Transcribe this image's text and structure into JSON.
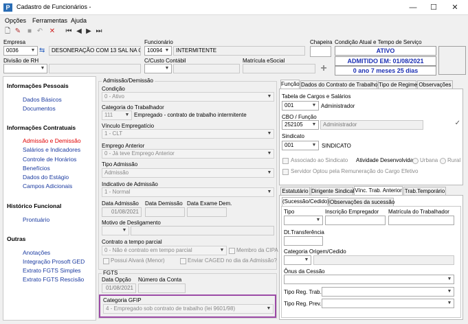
{
  "window": {
    "title": "Cadastro de Funcionários -",
    "icon_letter": "P",
    "minimize": "—",
    "maximize": "☐",
    "close": "✕"
  },
  "menu": [
    "Opções",
    "Ferramentas",
    "Ajuda"
  ],
  "header": {
    "empresa_label": "Empresa",
    "empresa_code": "0036",
    "empresa_name": "DESONERAÇÃO COM 13 SAL NA QUITAÇÃO",
    "funcionario_label": "Funcionário",
    "funcionario_code": "10094",
    "funcionario_name": "INTERMITENTE",
    "chapeira_label": "Chapeira",
    "condicao_label": "Condição Atual e Tempo de Serviço",
    "status_ativo": "ATIVO",
    "status_admitido": "ADMITIDO EM: 01/08/2021",
    "status_tempo": "0 ano 7 meses 25 dias",
    "divisao_label": "Divisão de RH",
    "custo_label": "C/Custo Contábil",
    "matricula_label": "Matrícula eSocial",
    "add_icon": "+"
  },
  "sidebar": {
    "sections": [
      {
        "title": "Informações Pessoais",
        "items": [
          "Dados Básicos",
          "Documentos"
        ]
      },
      {
        "title": "Informações Contratuais",
        "items": [
          "Admissão e Demissão",
          "Salários e Indicadores",
          "Controle de Horários",
          "Benefícios",
          "Dados do Estágio",
          "Campos Adicionais"
        ]
      },
      {
        "title": "Histórico Funcional",
        "items": [
          "Prontuário"
        ]
      },
      {
        "title": "Outras",
        "items": [
          "Anotações",
          "Integração Prosoft GED",
          "Extrato FGTS Simples",
          "Extrato FGTS Rescisão"
        ]
      }
    ]
  },
  "admissao": {
    "group_title": "Admissão/Demissão",
    "condicao_label": "Condição",
    "condicao_value": "0 - Ativo",
    "categoria_label": "Categoria do Trabalhador",
    "categoria_code": "111",
    "categoria_desc": "Empregado - contrato de trabalho intermitente",
    "vinculo_label": "Vínculo Empregatício",
    "vinculo_value": "1 - CLT",
    "emprego_label": "Emprego Anterior",
    "emprego_value": "0 - Já teve Emprego Anterior",
    "tipo_label": "Tipo Admissão",
    "tipo_value": "Admissão",
    "indicativo_label": "Indicativo de Admissão",
    "indicativo_value": "1 - Normal",
    "data_adm_label": "Data Admissão",
    "data_adm_value": "01/08/2021",
    "data_dem_label": "Data Demissão",
    "data_exame_label": "Data Exame Dem.",
    "motivo_label": "Motivo de Desligamento",
    "contrato_label": "Contrato a tempo parcial",
    "contrato_value": "0 - Não é contrato em tempo parcial",
    "cipa_label": "Membro da CIPA",
    "alvara_label": "Possui Alvará (Menor)",
    "caged_label": "Enviar CAGED no dia da Admissão?"
  },
  "fgts": {
    "group_title": "FGTS",
    "data_opcao_label": "Data Opção",
    "data_opcao_value": "01/08/2021",
    "conta_label": "Número da Conta",
    "gfip_label": "Categoria GFIP",
    "gfip_value": "4 - Empregado sob contrato de trabalho (lei 9601/98)"
  },
  "right_tabs": [
    "Função",
    "Dados do Contrato de Trabalho",
    "Tipo de Regime",
    "Observações"
  ],
  "funcao": {
    "tabela_label": "Tabela de Cargos e Salários",
    "tabela_code": "001",
    "tabela_desc": "Administrador",
    "cbo_label": "CBO / Função",
    "cbo_code": "252105",
    "cbo_desc": "Administrador",
    "sindicato_label": "Sindicato",
    "sindicato_code": "001",
    "sindicato_desc": "SINDICATO",
    "associado_label": "Associado ao Sindicato",
    "atividade_label": "Atividade Desenvolvida:",
    "urbana_label": "Urbana",
    "rural_label": "Rural",
    "servidor_label": "Servidor Optou pela Remuneração do Cargo Efetivo",
    "check_icon": "✓"
  },
  "lower_tabs": [
    "Estatutário",
    "Dirigente Sindical",
    "Vínc. Trab. Anterior",
    "Trab.Temporário"
  ],
  "sub_tabs": [
    "(Sucessão/Cedido)",
    "Observações da sucessão"
  ],
  "vinculo": {
    "tipo_label": "Tipo",
    "inscricao_label": "Inscrição Empregador",
    "matricula_label": "Matrícula do Trabalhador",
    "transferencia_label": "Dt.Transferência",
    "categoria_label": "Categoria Origem/Cedido",
    "onus_label": "Ônus da Cessão",
    "reg_trab_label": "Tipo Reg. Trab.",
    "reg_prev_label": "Tipo Reg. Prev."
  }
}
